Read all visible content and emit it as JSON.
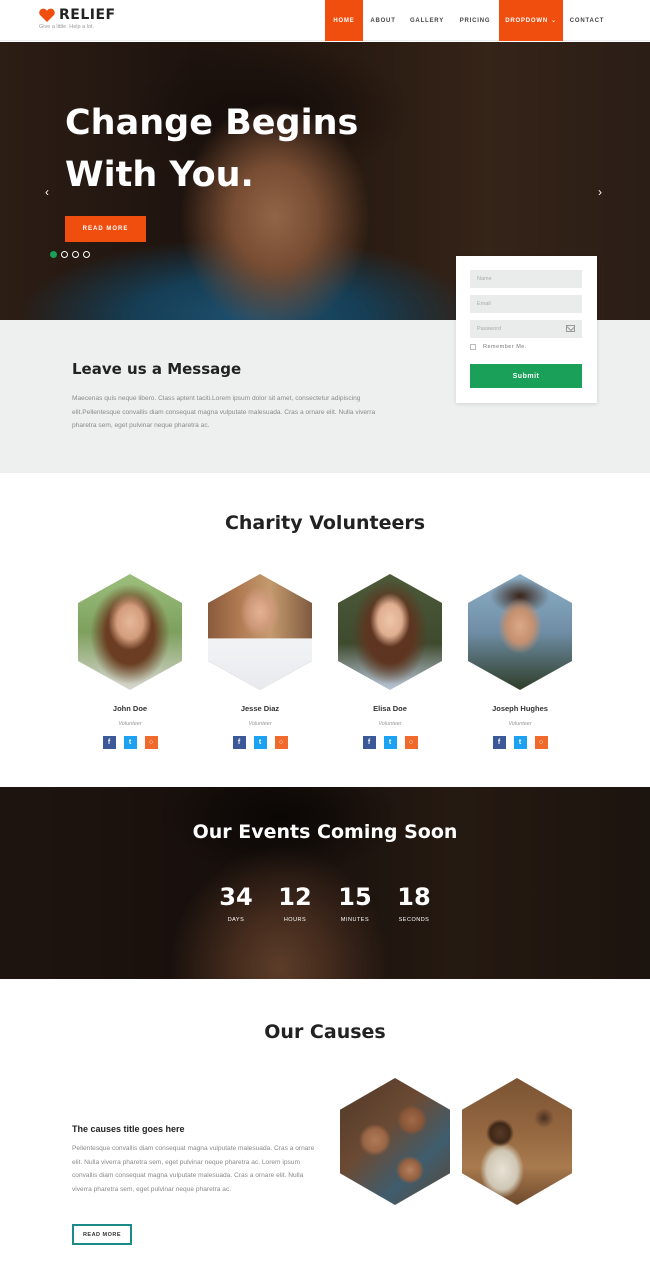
{
  "brand": {
    "name": "RELIEF",
    "tagline": "Give a little. Help a lot.",
    "accent": "#f04e0f",
    "green": "#1aa058"
  },
  "nav": {
    "items": [
      {
        "label": "HOME",
        "active": true
      },
      {
        "label": "ABOUT",
        "active": false
      },
      {
        "label": "GALLERY",
        "active": false
      },
      {
        "label": "PRICING",
        "active": false
      },
      {
        "label": "DROPDOWN",
        "active": true,
        "icon": "chevron-down-icon"
      },
      {
        "label": "CONTACT",
        "active": false
      }
    ]
  },
  "hero": {
    "title_line1": "Change Begins",
    "title_line2": "With You.",
    "button": "READ MORE",
    "prev_icon": "chevron-left-icon",
    "next_icon": "chevron-right-icon",
    "slides": 4,
    "active_slide": 1
  },
  "form": {
    "name_placeholder": "Name",
    "email_placeholder": "Email",
    "password_placeholder": "Password",
    "remember": "Remember Me.",
    "submit": "Submit"
  },
  "message": {
    "title": "Leave us a Message",
    "text": "Maecenas quis neque libero. Class aptent taciti.Lorem ipsum dolor sit amet, consectetur adipiscing elit.Pellentesque convallis diam consequat magna vulputate malesuada. Cras a ornare elit. Nulla viverra pharetra sem, eget pulvinar neque pharetra ac."
  },
  "volunteers": {
    "title": "Charity Volunteers",
    "people": [
      {
        "name": "John Doe",
        "role": "Volunteer"
      },
      {
        "name": "Jesse Diaz",
        "role": "Volunteer"
      },
      {
        "name": "Elisa Doe",
        "role": "Volunteer"
      },
      {
        "name": "Joseph Hughes",
        "role": "Volunteer"
      }
    ],
    "social_icons": [
      "facebook-icon",
      "twitter-icon",
      "instagram-icon"
    ]
  },
  "events": {
    "title": "Our Events Coming Soon",
    "countdown": [
      {
        "value": "34",
        "label": "DAYS"
      },
      {
        "value": "12",
        "label": "HOURS"
      },
      {
        "value": "15",
        "label": "MINUTES"
      },
      {
        "value": "18",
        "label": "SECONDS"
      }
    ]
  },
  "causes": {
    "title": "Our Causes",
    "item_title": "The causes title goes here",
    "item_text": "Pellentesque convallis diam consequat magna vulputate malesuada. Cras a ornare elit. Nulla viverra pharetra sem, eget pulvinar neque pharetra ac. Lorem ipsum convallis diam consequat magna vulputate malesuada. Cras a ornare elit. Nulla viverra pharetra sem, eget pulvinar neque pharetra ac.",
    "button": "READ MORE"
  }
}
